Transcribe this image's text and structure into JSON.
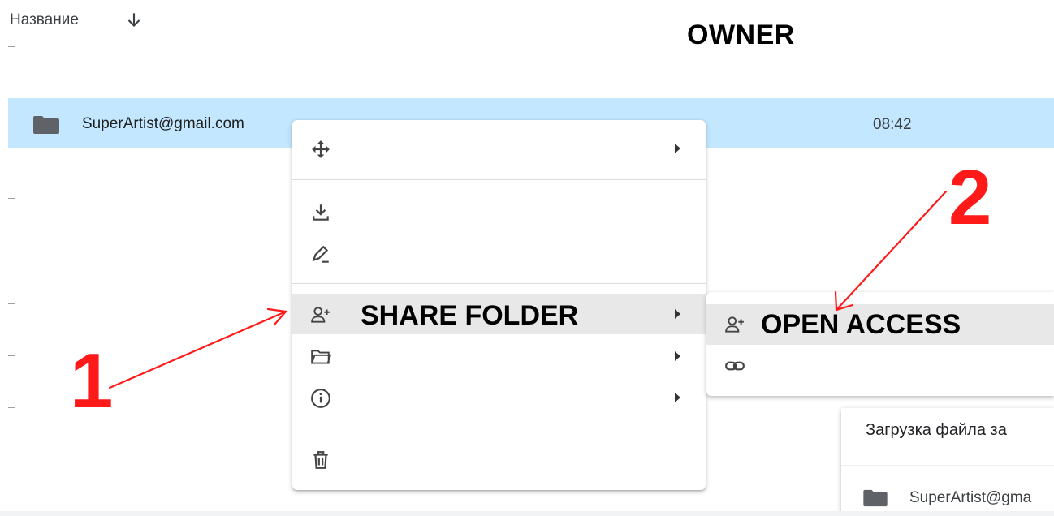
{
  "header": {
    "name_column": "Название",
    "sort_icon": "arrow-down-icon",
    "owner_label": "OWNER"
  },
  "file_row": {
    "icon": "folder-icon",
    "name": "SuperArtist@gmail.com",
    "time": "08:42"
  },
  "context_menu": {
    "items": [
      {
        "icon": "move-icon",
        "label": "",
        "has_submenu": true
      },
      {
        "icon": "download-icon",
        "label": "",
        "has_submenu": false
      },
      {
        "icon": "rename-icon",
        "label": "",
        "has_submenu": false
      },
      {
        "icon": "person-add-icon",
        "label": "SHARE FOLDER",
        "has_submenu": true,
        "highlighted": true
      },
      {
        "icon": "folder-open-icon",
        "label": "",
        "has_submenu": true
      },
      {
        "icon": "info-icon",
        "label": "",
        "has_submenu": true
      },
      {
        "icon": "trash-icon",
        "label": "",
        "has_submenu": false
      }
    ]
  },
  "share_submenu": {
    "items": [
      {
        "icon": "person-add-icon",
        "label": "OPEN ACCESS",
        "highlighted": true
      },
      {
        "icon": "link-icon",
        "label": ""
      }
    ]
  },
  "upload_panel": {
    "title": "Загрузка файла за",
    "file_icon": "folder-icon",
    "file_name": "SuperArtist@gma"
  },
  "annotations": {
    "step1": "1",
    "step2": "2",
    "color": "#ff1a1a"
  },
  "colors": {
    "selected_row": "#c2e7ff",
    "menu_highlight": "#e8e8e8"
  }
}
